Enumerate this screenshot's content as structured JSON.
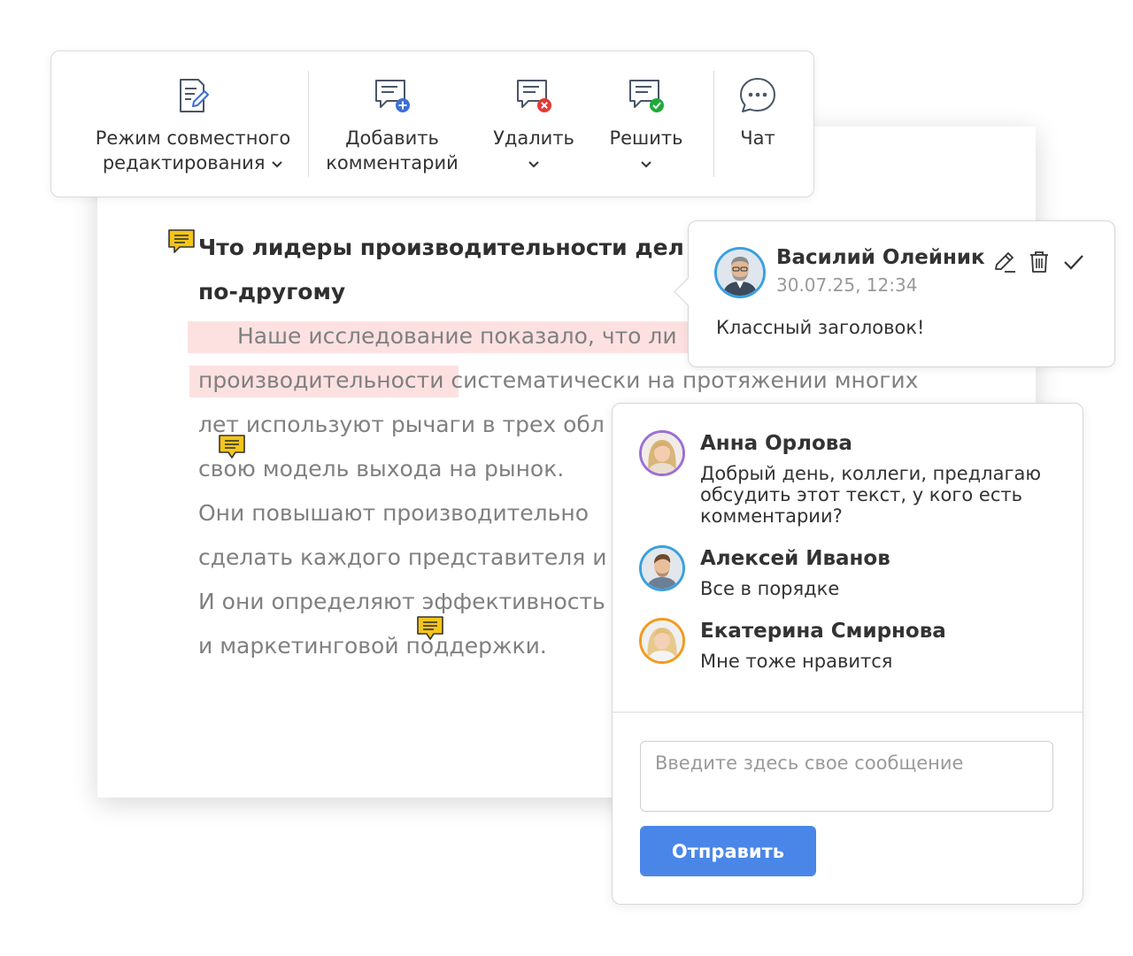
{
  "toolbar": {
    "coedit_label_line1": "Режим совместного",
    "coedit_label_line2": "редактирования",
    "add_comment_line1": "Добавить",
    "add_comment_line2": "комментарий",
    "delete_label": "Удалить",
    "resolve_label": "Решить",
    "chat_label": "Чат",
    "icons": {
      "coedit": "document-edit-icon",
      "add_comment": "comment-add-icon",
      "delete": "comment-delete-icon",
      "resolve": "comment-resolve-icon",
      "chat": "chat-bubble-icon",
      "dropdown": "chevron-down-icon"
    }
  },
  "document": {
    "title_line1": "Что лидеры производительности дел",
    "title_line2": "по-другому",
    "para_line1": "Наше исследование показало, что ли",
    "para_line2_hl": "производительности",
    "para_line2_rest": " систематически на протяжении многих",
    "para_line3": "лет используют рычаги в трех обл",
    "para_line4": "свою модель выхода на рынок.",
    "para_line5": "Они повышают производительно",
    "para_line6": "сделать каждого представителя и",
    "para_line7": "И они определяют эффективность",
    "para_line8": "и маркетинговой поддержки."
  },
  "comment": {
    "author": "Василий Олейник",
    "time": "30.07.25, 12:34",
    "text": "Классный заголовок!",
    "icons": [
      "edit-pencil-icon",
      "trash-icon",
      "checkmark-icon"
    ]
  },
  "chat": {
    "messages": [
      {
        "name": "Анна Орлова",
        "text": "Добрый день, коллеги, предлагаю обсудить этот текст, у кого есть комментарии?",
        "ring": "#9b6fd6"
      },
      {
        "name": "Алексей Иванов",
        "text": "Все в порядке",
        "ring": "#3aa0e0"
      },
      {
        "name": "Екатерина Смирнова",
        "text": "Мне тоже нравится",
        "ring": "#f39a1e"
      }
    ],
    "input_placeholder": "Введите здесь свое сообщение",
    "send_label": "Отправить"
  },
  "colors": {
    "accent": "#4a86e8",
    "highlight": "#fde1e1",
    "note_icon": "#f5c518",
    "delete_badge": "#e53935",
    "resolve_badge": "#1faa3a",
    "add_badge": "#3d6fd6"
  }
}
